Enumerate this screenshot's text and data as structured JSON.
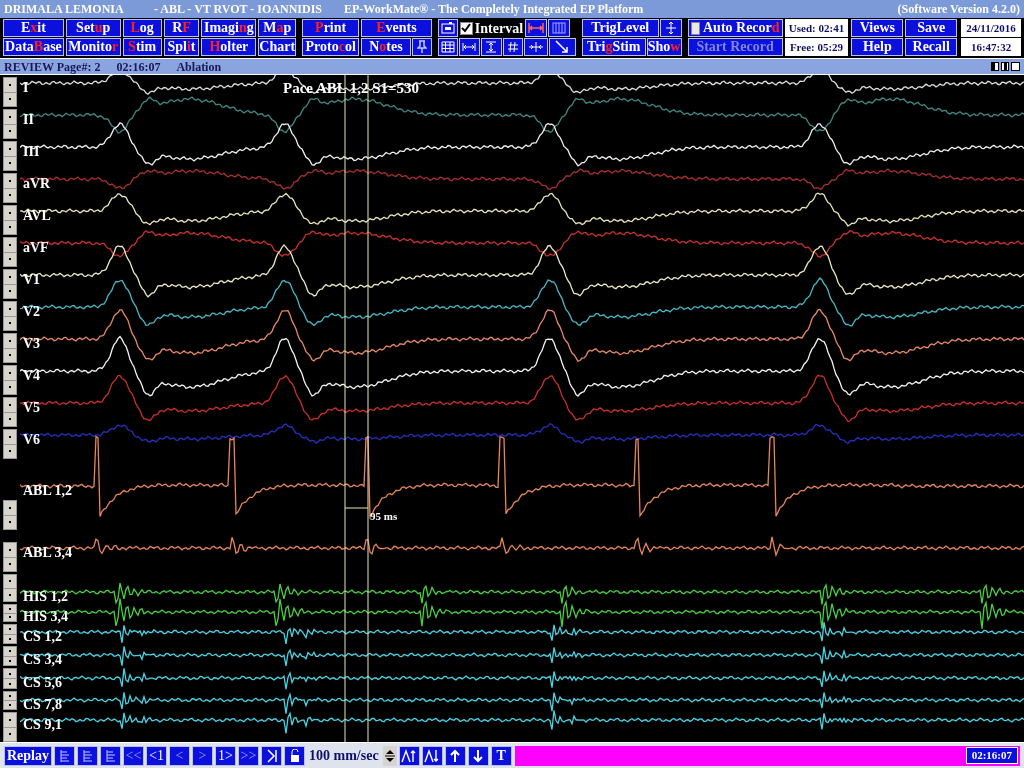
{
  "title_bar": {
    "patient": "DRIMALA LEMONIA",
    "study": "-  ABL - VT RVOT - IOANNIDIS",
    "app": "EP-WorkMate®  -  The Completely Integrated EP Platform",
    "version": "(Software Version 4.2.0)"
  },
  "menu_columns": [
    {
      "top": {
        "parts": [
          {
            "text": "E",
            "hot": false
          },
          {
            "text": "x",
            "hot": true
          },
          {
            "text": "it",
            "hot": false
          }
        ]
      },
      "bottom": {
        "parts": [
          {
            "text": "Data",
            "hot": false
          },
          {
            "text": "B",
            "hot": true
          },
          {
            "text": "ase",
            "hot": false
          }
        ]
      }
    },
    {
      "top": {
        "parts": [
          {
            "text": "Set",
            "hot": false
          },
          {
            "text": "u",
            "hot": true
          },
          {
            "text": "p",
            "hot": false
          }
        ]
      },
      "bottom": {
        "parts": [
          {
            "text": "Monito",
            "hot": false
          },
          {
            "text": "r",
            "hot": true
          }
        ]
      }
    },
    {
      "top": {
        "parts": [
          {
            "text": "L",
            "hot": true
          },
          {
            "text": "og",
            "hot": false
          }
        ]
      },
      "bottom": {
        "parts": [
          {
            "text": "S",
            "hot": true
          },
          {
            "text": "tim",
            "hot": false
          }
        ]
      }
    },
    {
      "top": {
        "parts": [
          {
            "text": "R",
            "hot": false
          },
          {
            "text": "F",
            "hot": true
          }
        ]
      },
      "bottom": {
        "parts": [
          {
            "text": "Spl",
            "hot": false
          },
          {
            "text": "i",
            "hot": true
          },
          {
            "text": "t",
            "hot": false
          }
        ]
      }
    },
    {
      "top": {
        "parts": [
          {
            "text": "Imagi",
            "hot": false
          },
          {
            "text": "n",
            "hot": true
          },
          {
            "text": "g",
            "hot": false
          }
        ]
      },
      "bottom": {
        "parts": [
          {
            "text": "H",
            "hot": true
          },
          {
            "text": "olter",
            "hot": false
          }
        ]
      }
    },
    {
      "top": {
        "parts": [
          {
            "text": "M",
            "hot": false
          },
          {
            "text": "a",
            "hot": true
          },
          {
            "text": "p",
            "hot": false
          }
        ]
      },
      "bottom": {
        "parts": [
          {
            "text": "Chart",
            "hot": false
          }
        ]
      }
    },
    {
      "top": {
        "parts": [
          {
            "text": "P",
            "hot": true
          },
          {
            "text": "rint",
            "hot": false
          }
        ]
      },
      "bottom": {
        "parts": [
          {
            "text": "Proto",
            "hot": false
          },
          {
            "text": "c",
            "hot": true
          },
          {
            "text": "ol",
            "hot": false
          }
        ]
      }
    },
    {
      "top": {
        "parts": [
          {
            "text": "E",
            "hot": true
          },
          {
            "text": "vents",
            "hot": false
          }
        ]
      },
      "bottom": {
        "parts": [
          {
            "text": "N",
            "hot": false
          },
          {
            "text": "o",
            "hot": true
          },
          {
            "text": "tes",
            "hot": false
          }
        ]
      }
    }
  ],
  "interval": {
    "label": "Interval",
    "checked": true
  },
  "trig": {
    "level": {
      "parts": [
        {
          "text": "TrigLevel",
          "hot": false
        }
      ]
    },
    "stim": {
      "parts": [
        {
          "text": "Tri",
          "hot": false
        },
        {
          "text": "g",
          "hot": true
        },
        {
          "text": "Stim",
          "hot": false
        }
      ]
    },
    "show": {
      "parts": [
        {
          "text": "Sho",
          "hot": false
        },
        {
          "text": "w",
          "hot": true
        }
      ]
    }
  },
  "auto_record": {
    "parts": [
      {
        "text": "Auto Recor",
        "hot": false
      },
      {
        "text": "d",
        "hot": true
      }
    ],
    "checked": false
  },
  "start_record": {
    "parts": [
      {
        "text": "Start Record",
        "hot": false
      }
    ],
    "disabled": true
  },
  "storage": {
    "used": "Used: 02:41",
    "free": "Free: 05:29"
  },
  "right_buttons": [
    {
      "top": {
        "parts": [
          {
            "text": "Views",
            "hot": false
          }
        ]
      },
      "bottom": {
        "parts": [
          {
            "text": "Help",
            "hot": false
          }
        ]
      }
    },
    {
      "top": {
        "parts": [
          {
            "text": "Save",
            "hot": false
          }
        ]
      },
      "bottom": {
        "parts": [
          {
            "text": "Recall",
            "hot": false
          }
        ]
      }
    }
  ],
  "clock": {
    "date": "24/11/2016",
    "time": "16:47:32"
  },
  "review_bar": {
    "page": "REVIEW Page#: 2",
    "time": "02:16:07",
    "mode": "Ablation"
  },
  "annotation": "Pace ABL 1,2 S1=530",
  "measurement": "95 ms",
  "channels": [
    {
      "name": "I",
      "color": "#e0e0e0"
    },
    {
      "name": "II",
      "color": "#3f8a84"
    },
    {
      "name": "III",
      "color": "#f0f0f0"
    },
    {
      "name": "aVR",
      "color": "#a8302c"
    },
    {
      "name": "AVL",
      "color": "#e8e6b8"
    },
    {
      "name": "aVF",
      "color": "#c8322c"
    },
    {
      "name": "V1",
      "color": "#ecebc4"
    },
    {
      "name": "V2",
      "color": "#46b8c8"
    },
    {
      "name": "V3",
      "color": "#e88a64"
    },
    {
      "name": "V4",
      "color": "#f4f4f4"
    },
    {
      "name": "V5",
      "color": "#c83028"
    },
    {
      "name": "V6",
      "color": "#2430c0"
    },
    {
      "name": "ABL 1,2",
      "color": "#e8865a"
    },
    {
      "name": "ABL 3,4",
      "color": "#e8865a"
    },
    {
      "name": "HIS 1,2",
      "color": "#48d040"
    },
    {
      "name": "HIS 3,4",
      "color": "#48d040"
    },
    {
      "name": "CS 1,2",
      "color": "#48d4e4"
    },
    {
      "name": "CS 3,4",
      "color": "#48d4e4"
    },
    {
      "name": "CS 5,6",
      "color": "#48d4e4"
    },
    {
      "name": "CS 7,8",
      "color": "#48d4e4"
    },
    {
      "name": "CS 9,1",
      "color": "#48d4e4"
    }
  ],
  "bottom_bar": {
    "replay": {
      "label": "Replay"
    },
    "nav_buttons": [
      {
        "label": "<<",
        "disabled": true
      },
      {
        "label": "<1",
        "disabled": false
      },
      {
        "label": "<",
        "disabled": true
      },
      {
        "label": ">",
        "disabled": true
      },
      {
        "label": "1>",
        "disabled": false
      },
      {
        "label": ">>",
        "disabled": true
      }
    ],
    "speed": "100 mm/sec",
    "text_button": {
      "label": "T"
    },
    "time": "02:16:07"
  }
}
